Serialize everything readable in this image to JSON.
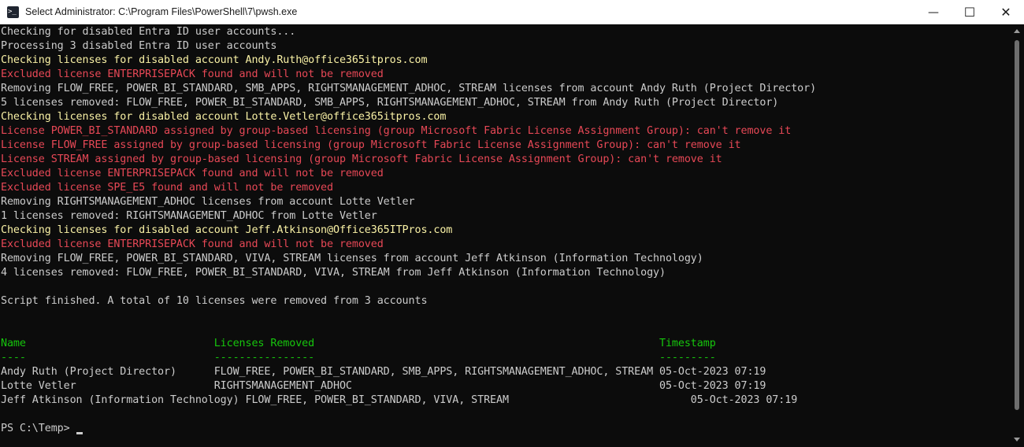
{
  "window": {
    "title": "Select Administrator: C:\\Program Files\\PowerShell\\7\\pwsh.exe",
    "icon": "terminal-icon",
    "controls": {
      "minimize": "—",
      "maximize": "☐",
      "close": "✕"
    }
  },
  "colors": {
    "background": "#0c0c0c",
    "default_text": "#cccccc",
    "yellow_text": "#f9f1a5",
    "red_text": "#e74856",
    "green_text": "#16c60c"
  },
  "terminal": {
    "output": [
      "Checking for disabled Entra ID user accounts...",
      "Processing 3 disabled Entra ID user accounts",
      "Checking licenses for disabled account Andy.Ruth@office365itpros.com",
      "Excluded license ENTERPRISEPACK found and will not be removed",
      "Removing FLOW_FREE, POWER_BI_STANDARD, SMB_APPS, RIGHTSMANAGEMENT_ADHOC, STREAM licenses from account Andy Ruth (Project Director)",
      "5 licenses removed: FLOW_FREE, POWER_BI_STANDARD, SMB_APPS, RIGHTSMANAGEMENT_ADHOC, STREAM from Andy Ruth (Project Director)",
      "Checking licenses for disabled account Lotte.Vetler@office365itpros.com",
      "License POWER_BI_STANDARD assigned by group-based licensing (group Microsoft Fabric License Assignment Group): can't remove it",
      "License FLOW_FREE assigned by group-based licensing (group Microsoft Fabric License Assignment Group): can't remove it",
      "License STREAM assigned by group-based licensing (group Microsoft Fabric License Assignment Group): can't remove it",
      "Excluded license ENTERPRISEPACK found and will not be removed",
      "Excluded license SPE_E5 found and will not be removed",
      "Removing RIGHTSMANAGEMENT_ADHOC licenses from account Lotte Vetler",
      "1 licenses removed: RIGHTSMANAGEMENT_ADHOC from Lotte Vetler",
      "Checking licenses for disabled account Jeff.Atkinson@Office365ITPros.com",
      "Excluded license ENTERPRISEPACK found and will not be removed",
      "Removing FLOW_FREE, POWER_BI_STANDARD, VIVA, STREAM licenses from account Jeff Atkinson (Information Technology)",
      "4 licenses removed: FLOW_FREE, POWER_BI_STANDARD, VIVA, STREAM from Jeff Atkinson (Information Technology)",
      "",
      "Script finished. A total of 10 licenses were removed from 3 accounts"
    ],
    "table": {
      "header": "Name                              Licenses Removed                                                       Timestamp",
      "separator": "----                              ----------------                                                       ---------",
      "rows": [
        "Andy Ruth (Project Director)      FLOW_FREE, POWER_BI_STANDARD, SMB_APPS, RIGHTSMANAGEMENT_ADHOC, STREAM 05-Oct-2023 07:19",
        "Lotte Vetler                      RIGHTSMANAGEMENT_ADHOC                                                 05-Oct-2023 07:19",
        "Jeff Atkinson (Information Technology) FLOW_FREE, POWER_BI_STANDARD, VIVA, STREAM                             05-Oct-2023 07:19"
      ]
    },
    "prompt": "PS C:\\Temp> "
  }
}
